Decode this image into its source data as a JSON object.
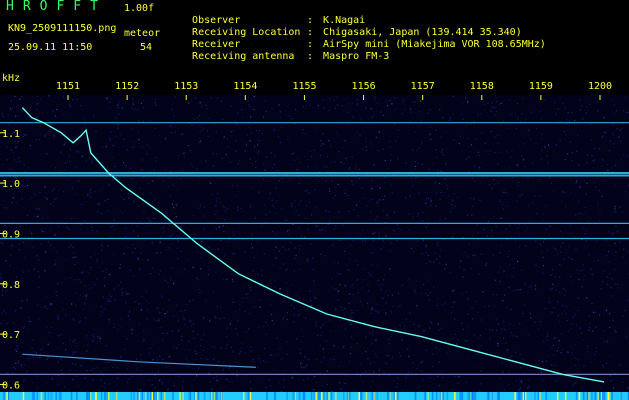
{
  "header": {
    "title": "HROFFT",
    "version": "1.00f",
    "filename": "KN9_2509111150.png",
    "datetime": "25.09.11 11:50",
    "meteor_label": "meteor",
    "meteor_count": "54"
  },
  "meta": [
    {
      "key": "Observer",
      "value": "K.Nagai"
    },
    {
      "key": "Receiving Location",
      "value": "Chigasaki, Japan (139.414 35.340)"
    },
    {
      "key": "Receiver",
      "value": "AirSpy mini (Miakejima VOR 108.65MHz)"
    },
    {
      "key": "Receiving antenna",
      "value": "Maspro FM-3"
    }
  ],
  "colors": {
    "background": "#000000",
    "text": "#ffff33",
    "title": "#33ff66",
    "noise": "#1a2a9a",
    "carrier": "#33ccff",
    "trail": "#66ffee"
  },
  "chart_data": {
    "type": "heatmap",
    "ylabel": "kHz",
    "x_ticks": [
      "1151",
      "1152",
      "1153",
      "1154",
      "1155",
      "1156",
      "1157",
      "1158",
      "1159",
      "1200"
    ],
    "y_ticks": [
      "1.1",
      "1.0",
      "0.9",
      "0.8",
      "0.7",
      "0.6"
    ],
    "xlim": [
      11.5,
      12.0
    ],
    "ylim": [
      0.585,
      1.175
    ],
    "carriers_khz": [
      1.12,
      1.02,
      1.015,
      0.92,
      0.89,
      0.62
    ],
    "descending_trail": [
      [
        11.502,
        1.15
      ],
      [
        11.51,
        1.13
      ],
      [
        11.52,
        1.12
      ],
      [
        11.535,
        1.1
      ],
      [
        11.545,
        1.08
      ],
      [
        11.552,
        1.095
      ],
      [
        11.556,
        1.105
      ],
      [
        11.56,
        1.06
      ],
      [
        11.575,
        1.02
      ],
      [
        11.59,
        0.99
      ],
      [
        11.62,
        0.94
      ],
      [
        11.65,
        0.88
      ],
      [
        11.685,
        0.82
      ],
      [
        11.72,
        0.78
      ],
      [
        11.76,
        0.74
      ],
      [
        11.8,
        0.715
      ],
      [
        11.84,
        0.695
      ],
      [
        11.88,
        0.67
      ],
      [
        11.92,
        0.645
      ],
      [
        11.96,
        0.62
      ],
      [
        11.995,
        0.605
      ]
    ],
    "low_trail": [
      [
        11.502,
        0.66
      ],
      [
        11.6,
        0.645
      ],
      [
        11.7,
        0.634
      ]
    ]
  }
}
